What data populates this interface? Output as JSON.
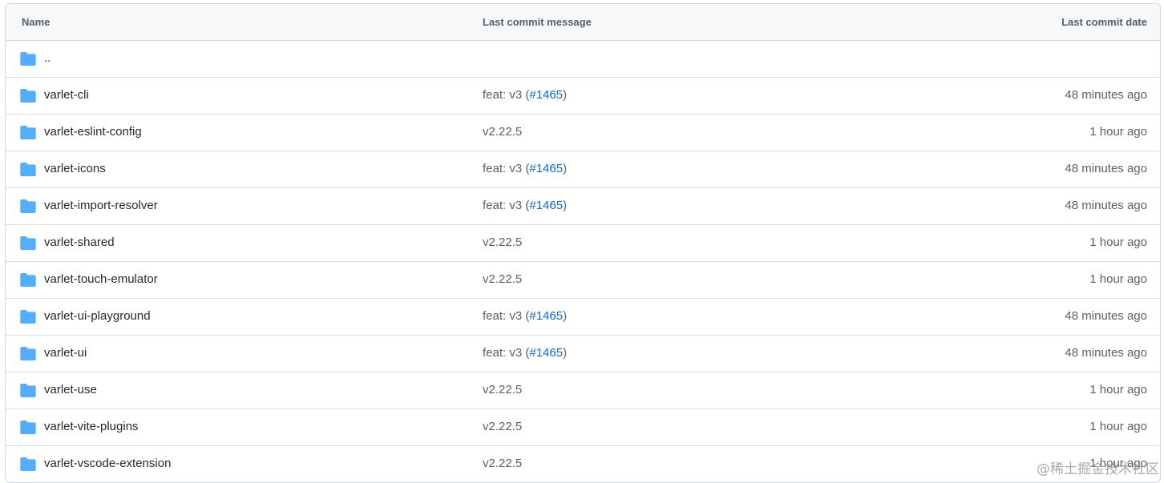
{
  "headers": {
    "name": "Name",
    "message": "Last commit message",
    "date": "Last commit date"
  },
  "parent_dir": "..",
  "rows": [
    {
      "name": "varlet-cli",
      "msg_prefix": "feat: v3 (",
      "msg_link": "#1465",
      "msg_suffix": ")",
      "date": "48 minutes ago"
    },
    {
      "name": "varlet-eslint-config",
      "msg_prefix": "v2.22.5",
      "msg_link": "",
      "msg_suffix": "",
      "date": "1 hour ago"
    },
    {
      "name": "varlet-icons",
      "msg_prefix": "feat: v3 (",
      "msg_link": "#1465",
      "msg_suffix": ")",
      "date": "48 minutes ago"
    },
    {
      "name": "varlet-import-resolver",
      "msg_prefix": "feat: v3 (",
      "msg_link": "#1465",
      "msg_suffix": ")",
      "date": "48 minutes ago"
    },
    {
      "name": "varlet-shared",
      "msg_prefix": "v2.22.5",
      "msg_link": "",
      "msg_suffix": "",
      "date": "1 hour ago"
    },
    {
      "name": "varlet-touch-emulator",
      "msg_prefix": "v2.22.5",
      "msg_link": "",
      "msg_suffix": "",
      "date": "1 hour ago"
    },
    {
      "name": "varlet-ui-playground",
      "msg_prefix": "feat: v3 (",
      "msg_link": "#1465",
      "msg_suffix": ")",
      "date": "48 minutes ago"
    },
    {
      "name": "varlet-ui",
      "msg_prefix": "feat: v3 (",
      "msg_link": "#1465",
      "msg_suffix": ")",
      "date": "48 minutes ago"
    },
    {
      "name": "varlet-use",
      "msg_prefix": "v2.22.5",
      "msg_link": "",
      "msg_suffix": "",
      "date": "1 hour ago"
    },
    {
      "name": "varlet-vite-plugins",
      "msg_prefix": "v2.22.5",
      "msg_link": "",
      "msg_suffix": "",
      "date": "1 hour ago"
    },
    {
      "name": "varlet-vscode-extension",
      "msg_prefix": "v2.22.5",
      "msg_link": "",
      "msg_suffix": "",
      "date": "1 hour ago"
    }
  ],
  "icon": "folder-icon",
  "colors": {
    "folder": "#54aeff",
    "link": "#0969da",
    "muted": "#57606a",
    "text": "#24292f",
    "header_bg": "#f6f8fa",
    "border": "#d0d7de"
  },
  "watermark": "@稀土掘金技术社区"
}
